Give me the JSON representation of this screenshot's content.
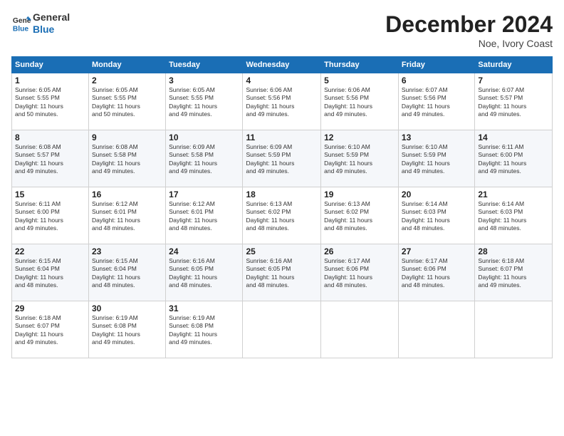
{
  "logo": {
    "line1": "General",
    "line2": "Blue"
  },
  "title": "December 2024",
  "location": "Noe, Ivory Coast",
  "days_of_week": [
    "Sunday",
    "Monday",
    "Tuesday",
    "Wednesday",
    "Thursday",
    "Friday",
    "Saturday"
  ],
  "weeks": [
    [
      {
        "day": "1",
        "info": "Sunrise: 6:05 AM\nSunset: 5:55 PM\nDaylight: 11 hours\nand 50 minutes."
      },
      {
        "day": "2",
        "info": "Sunrise: 6:05 AM\nSunset: 5:55 PM\nDaylight: 11 hours\nand 50 minutes."
      },
      {
        "day": "3",
        "info": "Sunrise: 6:05 AM\nSunset: 5:55 PM\nDaylight: 11 hours\nand 49 minutes."
      },
      {
        "day": "4",
        "info": "Sunrise: 6:06 AM\nSunset: 5:56 PM\nDaylight: 11 hours\nand 49 minutes."
      },
      {
        "day": "5",
        "info": "Sunrise: 6:06 AM\nSunset: 5:56 PM\nDaylight: 11 hours\nand 49 minutes."
      },
      {
        "day": "6",
        "info": "Sunrise: 6:07 AM\nSunset: 5:56 PM\nDaylight: 11 hours\nand 49 minutes."
      },
      {
        "day": "7",
        "info": "Sunrise: 6:07 AM\nSunset: 5:57 PM\nDaylight: 11 hours\nand 49 minutes."
      }
    ],
    [
      {
        "day": "8",
        "info": "Sunrise: 6:08 AM\nSunset: 5:57 PM\nDaylight: 11 hours\nand 49 minutes."
      },
      {
        "day": "9",
        "info": "Sunrise: 6:08 AM\nSunset: 5:58 PM\nDaylight: 11 hours\nand 49 minutes."
      },
      {
        "day": "10",
        "info": "Sunrise: 6:09 AM\nSunset: 5:58 PM\nDaylight: 11 hours\nand 49 minutes."
      },
      {
        "day": "11",
        "info": "Sunrise: 6:09 AM\nSunset: 5:59 PM\nDaylight: 11 hours\nand 49 minutes."
      },
      {
        "day": "12",
        "info": "Sunrise: 6:10 AM\nSunset: 5:59 PM\nDaylight: 11 hours\nand 49 minutes."
      },
      {
        "day": "13",
        "info": "Sunrise: 6:10 AM\nSunset: 5:59 PM\nDaylight: 11 hours\nand 49 minutes."
      },
      {
        "day": "14",
        "info": "Sunrise: 6:11 AM\nSunset: 6:00 PM\nDaylight: 11 hours\nand 49 minutes."
      }
    ],
    [
      {
        "day": "15",
        "info": "Sunrise: 6:11 AM\nSunset: 6:00 PM\nDaylight: 11 hours\nand 49 minutes."
      },
      {
        "day": "16",
        "info": "Sunrise: 6:12 AM\nSunset: 6:01 PM\nDaylight: 11 hours\nand 48 minutes."
      },
      {
        "day": "17",
        "info": "Sunrise: 6:12 AM\nSunset: 6:01 PM\nDaylight: 11 hours\nand 48 minutes."
      },
      {
        "day": "18",
        "info": "Sunrise: 6:13 AM\nSunset: 6:02 PM\nDaylight: 11 hours\nand 48 minutes."
      },
      {
        "day": "19",
        "info": "Sunrise: 6:13 AM\nSunset: 6:02 PM\nDaylight: 11 hours\nand 48 minutes."
      },
      {
        "day": "20",
        "info": "Sunrise: 6:14 AM\nSunset: 6:03 PM\nDaylight: 11 hours\nand 48 minutes."
      },
      {
        "day": "21",
        "info": "Sunrise: 6:14 AM\nSunset: 6:03 PM\nDaylight: 11 hours\nand 48 minutes."
      }
    ],
    [
      {
        "day": "22",
        "info": "Sunrise: 6:15 AM\nSunset: 6:04 PM\nDaylight: 11 hours\nand 48 minutes."
      },
      {
        "day": "23",
        "info": "Sunrise: 6:15 AM\nSunset: 6:04 PM\nDaylight: 11 hours\nand 48 minutes."
      },
      {
        "day": "24",
        "info": "Sunrise: 6:16 AM\nSunset: 6:05 PM\nDaylight: 11 hours\nand 48 minutes."
      },
      {
        "day": "25",
        "info": "Sunrise: 6:16 AM\nSunset: 6:05 PM\nDaylight: 11 hours\nand 48 minutes."
      },
      {
        "day": "26",
        "info": "Sunrise: 6:17 AM\nSunset: 6:06 PM\nDaylight: 11 hours\nand 48 minutes."
      },
      {
        "day": "27",
        "info": "Sunrise: 6:17 AM\nSunset: 6:06 PM\nDaylight: 11 hours\nand 48 minutes."
      },
      {
        "day": "28",
        "info": "Sunrise: 6:18 AM\nSunset: 6:07 PM\nDaylight: 11 hours\nand 49 minutes."
      }
    ],
    [
      {
        "day": "29",
        "info": "Sunrise: 6:18 AM\nSunset: 6:07 PM\nDaylight: 11 hours\nand 49 minutes."
      },
      {
        "day": "30",
        "info": "Sunrise: 6:19 AM\nSunset: 6:08 PM\nDaylight: 11 hours\nand 49 minutes."
      },
      {
        "day": "31",
        "info": "Sunrise: 6:19 AM\nSunset: 6:08 PM\nDaylight: 11 hours\nand 49 minutes."
      },
      null,
      null,
      null,
      null
    ]
  ]
}
